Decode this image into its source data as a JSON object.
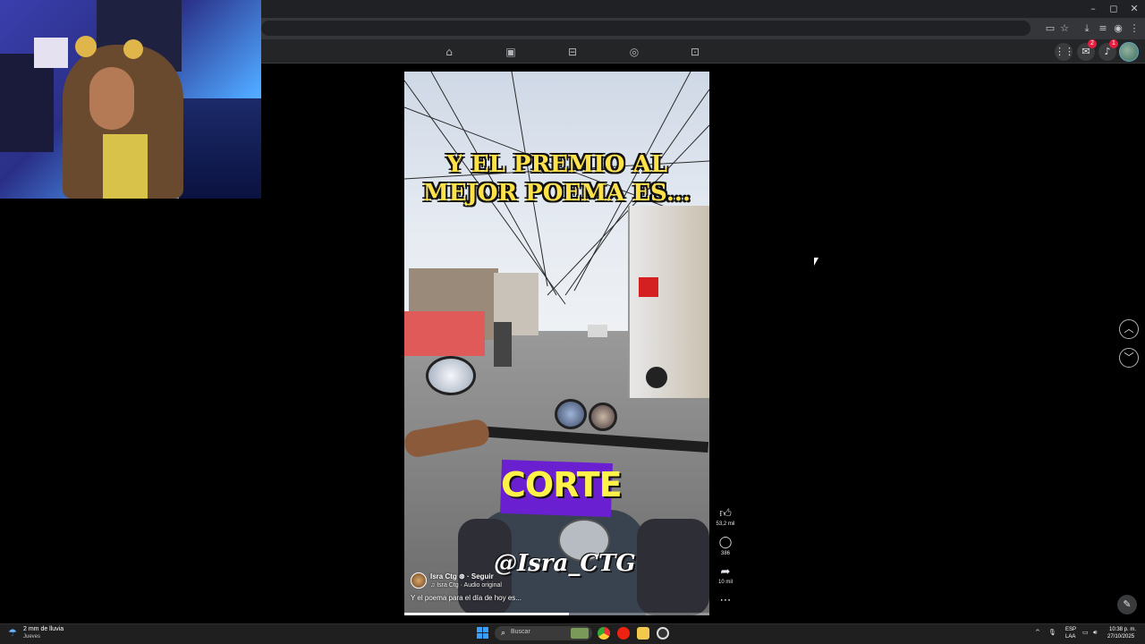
{
  "browser": {
    "window_controls": {
      "minimize": "–",
      "maximize": "◻",
      "close": "✕"
    },
    "toolbar_icons": [
      "cast-icon",
      "star-icon",
      "download-icon",
      "media-icon",
      "profile-icon",
      "menu-icon"
    ]
  },
  "facebook_nav": {
    "tabs": [
      "home-icon",
      "video-icon",
      "marketplace-icon",
      "groups-icon",
      "gaming-icon"
    ],
    "messenger_badge": "2",
    "notifications_badge": "1"
  },
  "reel": {
    "caption_top_line1": "Y EL PREMIO AL",
    "caption_top_line2": "MEJOR POEMA ES...",
    "sticker_text": "CORTE",
    "watermark": "@Isra_CTG",
    "author": "Isra Ctg",
    "follow_label": "· Seguir",
    "audio": "♫ Isra Ctg · Audio original",
    "post_caption": "Y el poema para el día de hoy es...",
    "progress": 0.54
  },
  "actions": {
    "likes": "53,2 mil",
    "comments": "386",
    "shares": "10 mil"
  },
  "taskbar": {
    "weather_temp": "2 mm de lluvia",
    "weather_day": "Jueves",
    "search_placeholder": "Buscar",
    "lang_top": "ESP",
    "lang_bottom": "LAA",
    "time": "10:38 p. m.",
    "date": "27/10/2025"
  }
}
